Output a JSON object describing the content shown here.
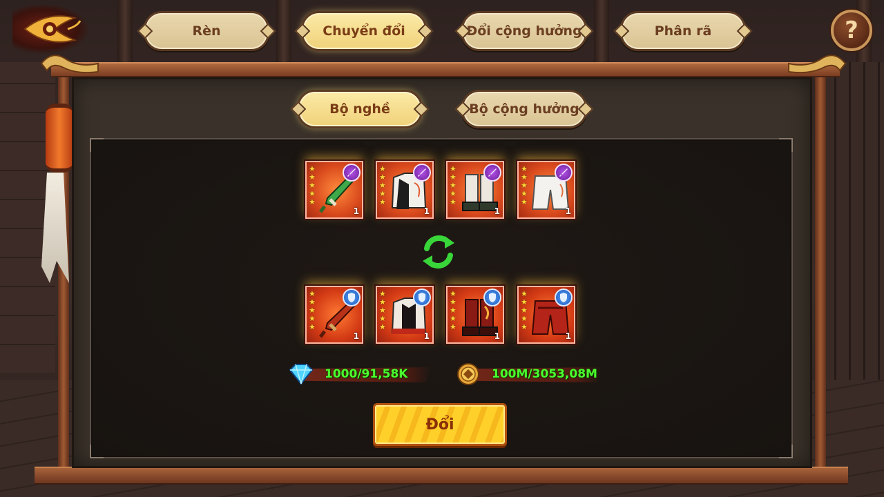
{
  "nav": {
    "back_icon": "eye-swirl-back-icon",
    "help_label": "?",
    "tabs": [
      {
        "label": "Rèn",
        "active": false
      },
      {
        "label": "Chuyển đổi",
        "active": true
      },
      {
        "label": "Đổi cộng hưởng",
        "active": false
      },
      {
        "label": "Phân rã",
        "active": false
      }
    ]
  },
  "subtabs": [
    {
      "label": "Bộ nghề",
      "active": true
    },
    {
      "label": "Bộ cộng hưởng",
      "active": false
    }
  ],
  "source_items": [
    {
      "kind": "sword",
      "stars": 5,
      "badge": "purple-dagger",
      "level": "1"
    },
    {
      "kind": "armor",
      "stars": 5,
      "badge": "purple-dagger",
      "level": "1"
    },
    {
      "kind": "boots",
      "stars": 5,
      "badge": "purple-dagger",
      "level": "1"
    },
    {
      "kind": "pants",
      "stars": 5,
      "badge": "purple-dagger",
      "level": "1"
    }
  ],
  "target_items": [
    {
      "kind": "sword",
      "stars": 5,
      "badge": "blue-shield",
      "level": "1"
    },
    {
      "kind": "armor",
      "stars": 5,
      "badge": "blue-shield",
      "level": "1"
    },
    {
      "kind": "boots",
      "stars": 5,
      "badge": "blue-shield",
      "level": "1"
    },
    {
      "kind": "pants",
      "stars": 5,
      "badge": "blue-shield",
      "level": "1"
    }
  ],
  "costs": {
    "gem": {
      "icon": "diamond-icon",
      "text": "1000/91,58K"
    },
    "coin": {
      "icon": "coin-icon",
      "text": "100M/3053,08M"
    }
  },
  "action": {
    "label": "Đổi"
  },
  "colors": {
    "tab_bg": "#e9d8ae",
    "tab_active_bg": "#f0d27a",
    "cost_text": "#4cff2e",
    "button": "#ffd02a",
    "purple_badge": "#8e35c4",
    "blue_badge": "#2f7ae0"
  }
}
